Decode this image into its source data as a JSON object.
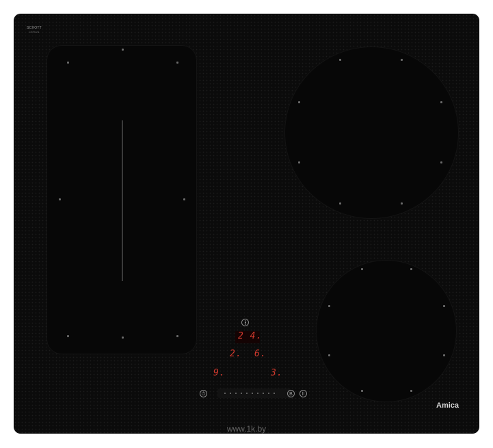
{
  "panel": {
    "logo_line1": "SCHOTT",
    "logo_line2": "CERAN",
    "brand": "Amica"
  },
  "display": {
    "timer": "2 4.",
    "zone_top_left": "2.",
    "zone_top_right": "6.",
    "zone_bottom_left": "9.",
    "zone_bottom_right": "3."
  },
  "controls": {
    "power_icon": "power-icon",
    "booster_label": "B",
    "pause_label": "II",
    "clock_icon": "clock-icon",
    "slider_steps": 10
  },
  "watermark": "www.1k.by",
  "colors": {
    "glass": "#0b0b0b",
    "display_red": "#d23a2e"
  }
}
